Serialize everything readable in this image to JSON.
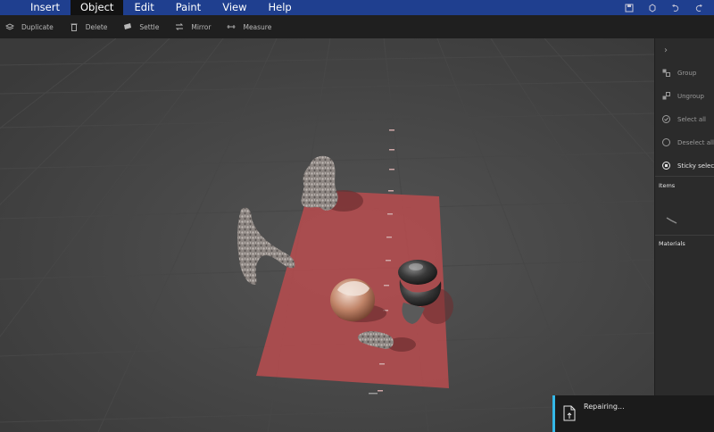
{
  "menubar": {
    "items": [
      "Insert",
      "Object",
      "Edit",
      "Paint",
      "View",
      "Help"
    ],
    "active_index": 1,
    "color": "#1f3f8f"
  },
  "toolbar": {
    "duplicate": "Duplicate",
    "delete": "Delete",
    "settle": "Settle",
    "mirror": "Mirror",
    "measure": "Measure"
  },
  "rightpanel": {
    "group": "Group",
    "ungroup": "Ungroup",
    "select_all": "Select all",
    "deselect_all": "Deselect all",
    "sticky_selection": "Sticky selection",
    "items_heading": "Items",
    "materials_heading": "Materials"
  },
  "toast": {
    "message": "Repairing...",
    "accent": "#34b8e8"
  },
  "viewport": {
    "print_bed_color": "#b54c4f"
  }
}
